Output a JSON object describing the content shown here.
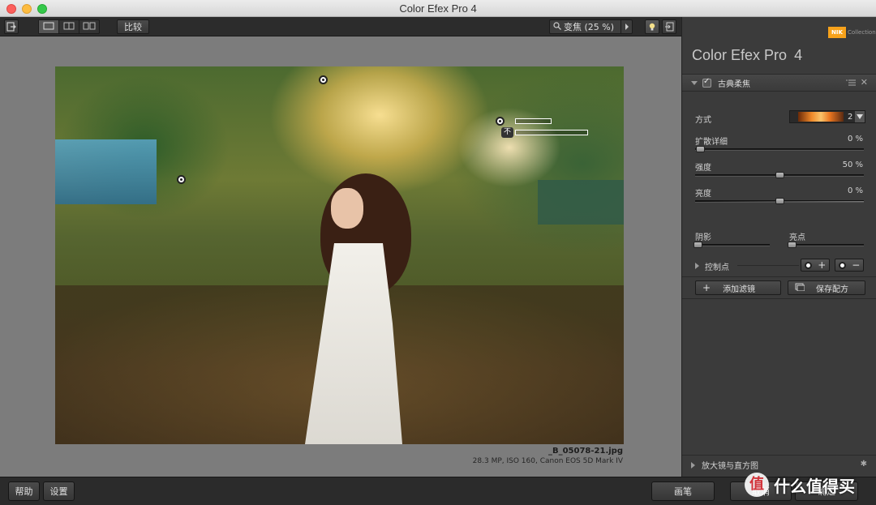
{
  "window": {
    "title": "Color Efex Pro 4"
  },
  "toolbar": {
    "compare_label": "比较",
    "zoom_label": "变焦 (25 %)",
    "icons": [
      "exit-icon",
      "single-view-icon",
      "split-view-icon",
      "side-by-side-icon",
      "search-icon",
      "play-arrow-icon",
      "lightbulb-icon",
      "export-icon"
    ]
  },
  "image": {
    "filename": "_B_05078-21.jpg",
    "meta": "28.3 MP, ISO 160, Canon EOS 5D Mark IV",
    "control_point_badge": "不"
  },
  "panel": {
    "brand": {
      "logo": "NIK",
      "collection": "Collection"
    },
    "app_title": "Color Efex Pro",
    "app_version": "4",
    "filter": {
      "name": "古典柔焦",
      "method_label": "方式",
      "method_value": "2",
      "sliders": [
        {
          "label": "扩散详细",
          "value": "0 %",
          "level": 0
        },
        {
          "label": "强度",
          "value": "50 %",
          "level": 50
        },
        {
          "label": "亮度",
          "value": "0 %",
          "level": 0
        }
      ],
      "shadows": {
        "label": "阴影",
        "level": 0
      },
      "highlights": {
        "label": "亮点",
        "level": 0
      },
      "control_points_label": "控制点"
    },
    "add_filter_label": "添加滤镜",
    "save_recipe_label": "保存配方",
    "loupe_label": "放大镜与直方图"
  },
  "bottom": {
    "help_label": "帮助",
    "settings_label": "设置",
    "brush_label": "画笔",
    "cancel_label": "取消",
    "ok_label": "确定"
  },
  "watermark": {
    "badge": "值",
    "text": "什么值得买"
  },
  "colors": {
    "accent": "#f7a21b",
    "panel_bg": "#3b3b3b",
    "canvas_bg": "#7c7c7c"
  }
}
